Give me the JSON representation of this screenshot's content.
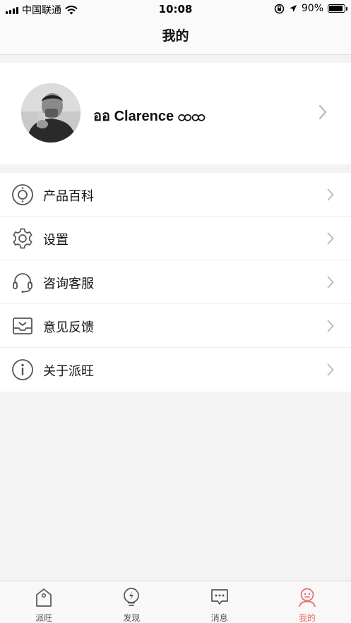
{
  "status_bar": {
    "carrier": "中国联通",
    "time": "10:08",
    "battery_percent": "90%",
    "battery_level": 0.9,
    "icons": [
      "signal-icon",
      "wifi-icon",
      "rotation-lock-icon",
      "location-icon",
      "battery-icon"
    ]
  },
  "nav": {
    "title": "我的"
  },
  "profile": {
    "name": "ออ Clarence ထထ"
  },
  "menu": {
    "items": [
      {
        "label": "产品百科",
        "icon": "product-encyclopedia-icon"
      },
      {
        "label": "设置",
        "icon": "gear-icon"
      },
      {
        "label": "咨询客服",
        "icon": "headset-icon"
      },
      {
        "label": "意见反馈",
        "icon": "inbox-icon"
      },
      {
        "label": "关于派旺",
        "icon": "info-icon"
      }
    ]
  },
  "tabs": [
    {
      "label": "派旺",
      "icon": "tag-icon"
    },
    {
      "label": "发现",
      "icon": "discover-bulb-icon"
    },
    {
      "label": "消息",
      "icon": "message-icon"
    },
    {
      "label": "我的",
      "icon": "profile-face-icon",
      "active": true
    }
  ],
  "colors": {
    "accent": "#ef6b6b",
    "background": "#f3f3f3",
    "chevron": "#b8b8b8",
    "icon": "#555555"
  }
}
